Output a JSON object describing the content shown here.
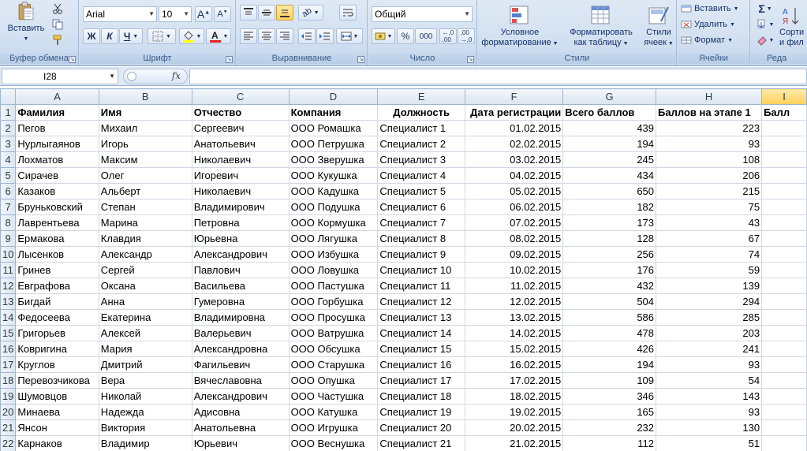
{
  "ribbon": {
    "clipboard": {
      "paste_label": "Вставить",
      "group_label": "Буфер обмена"
    },
    "font": {
      "font_name": "Arial",
      "font_size": "10",
      "bold": "Ж",
      "italic": "К",
      "underline": "Ч",
      "group_label": "Шрифт"
    },
    "alignment": {
      "group_label": "Выравнивание"
    },
    "number": {
      "format": "Общий",
      "percent": "%",
      "thousands": "000",
      "group_label": "Число"
    },
    "styles": {
      "conditional_line1": "Условное",
      "conditional_line2": "форматирование",
      "table_line1": "Форматировать",
      "table_line2": "как таблицу",
      "cell_styles_line1": "Стили",
      "cell_styles_line2": "ячеек",
      "group_label": "Стили"
    },
    "cells": {
      "insert": "Вставить",
      "delete": "Удалить",
      "format": "Формат",
      "group_label": "Ячейки"
    },
    "editing": {
      "sigma": "Σ",
      "sort_line1": "Сорти",
      "sort_line2": "и фил",
      "group_label": "Реда"
    }
  },
  "formula_bar": {
    "name_box": "I28",
    "fx": "fx",
    "formula": ""
  },
  "grid": {
    "column_headers": [
      "A",
      "B",
      "C",
      "D",
      "E",
      "F",
      "G",
      "H",
      "I"
    ],
    "header_row": [
      "Фамилия",
      "Имя",
      "Отчество",
      "Компания",
      "Должность",
      "Дата регистрации",
      "Всего баллов",
      "Баллов на этапе 1",
      "Балл"
    ],
    "rows": [
      [
        "Пегов",
        " Михаил",
        "Сергеевич",
        "ООО Ромашка",
        "Специалист 1",
        "01.02.2015",
        "439",
        "223"
      ],
      [
        "Нурлыгаянов",
        "Игорь",
        "Анатольевич",
        "ООО Петрушка",
        "Специалист 2",
        "02.02.2015",
        "194",
        "93"
      ],
      [
        "Лохматов",
        "Максим",
        "Николаевич",
        "ООО Зверушка",
        "Специалист 3",
        "03.02.2015",
        "245",
        "108"
      ],
      [
        "Сирачев",
        "Олег",
        "Игоревич",
        "ООО Кукушка",
        "Специалист 4",
        "04.02.2015",
        "434",
        "206"
      ],
      [
        "Казаков",
        "Альберт",
        "Николаевич",
        "ООО Кадушка",
        "Специалист 5",
        "05.02.2015",
        "650",
        "215"
      ],
      [
        "Бруньковский",
        "Степан",
        "Владимирович",
        "ООО Подушка",
        "Специалист 6",
        "06.02.2015",
        "182",
        "75"
      ],
      [
        "Лаврентьева",
        "Марина",
        "Петровна",
        "ООО Кормушка",
        "Специалист 7",
        "07.02.2015",
        "173",
        "43"
      ],
      [
        "Ермакова",
        "Клавдия",
        "Юрьевна",
        "ООО Лягушка",
        "Специалист 8",
        "08.02.2015",
        "128",
        "67"
      ],
      [
        "Лысенков",
        "Александр",
        "Александрович",
        "ООО Избушка",
        "Специалист 9",
        "09.02.2015",
        "256",
        "74"
      ],
      [
        "Гринев",
        "Сергей",
        "Павлович",
        "ООО Ловушка",
        "Специалист 10",
        "10.02.2015",
        "176",
        "59"
      ],
      [
        "Евграфова",
        "Оксана",
        "Васильева",
        "ООО Пастушка",
        "Специалист 11",
        "11.02.2015",
        "432",
        "139"
      ],
      [
        "Бигдай",
        "Анна",
        "Гумеровна",
        "ООО Горбушка",
        "Специалист 12",
        "12.02.2015",
        "504",
        "294"
      ],
      [
        "Федосеева",
        "Екатерина",
        "Владимировна",
        "ООО Просушка",
        "Специалист 13",
        "13.02.2015",
        "586",
        "285"
      ],
      [
        "Григорьев",
        "Алексей",
        "Валерьевич",
        "ООО Ватрушка",
        "Специалист 14",
        "14.02.2015",
        "478",
        "203"
      ],
      [
        "Ковригина",
        "Мария",
        "Александровна",
        "ООО Обсушка",
        "Специалист 15",
        "15.02.2015",
        "426",
        "241"
      ],
      [
        "Круглов",
        "Дмитрий",
        "Фагильевич",
        "ООО Старушка",
        "Специалист 16",
        "16.02.2015",
        "194",
        "93"
      ],
      [
        "Перевозчикова",
        "Вера",
        "Вячеславовна",
        "ООО Опушка",
        "Специалист 17",
        "17.02.2015",
        "109",
        "54"
      ],
      [
        "Шумовцов",
        "Николай",
        "Александрович",
        "ООО Частушка",
        "Специалист 18",
        "18.02.2015",
        "346",
        "143"
      ],
      [
        "Минаева",
        "Надежда",
        "Адисовна",
        "ООО Катушка",
        "Специалист 19",
        "19.02.2015",
        "165",
        "93"
      ],
      [
        "Янсон",
        "Виктория",
        "Анатольевна",
        "ООО Игрушка",
        "Специалист 20",
        "20.02.2015",
        "232",
        "130"
      ],
      [
        "Карнаков",
        "Владимир",
        "Юрьевич",
        "ООО Веснушка",
        "Специалист 21",
        "21.02.2015",
        "112",
        "51"
      ]
    ]
  }
}
